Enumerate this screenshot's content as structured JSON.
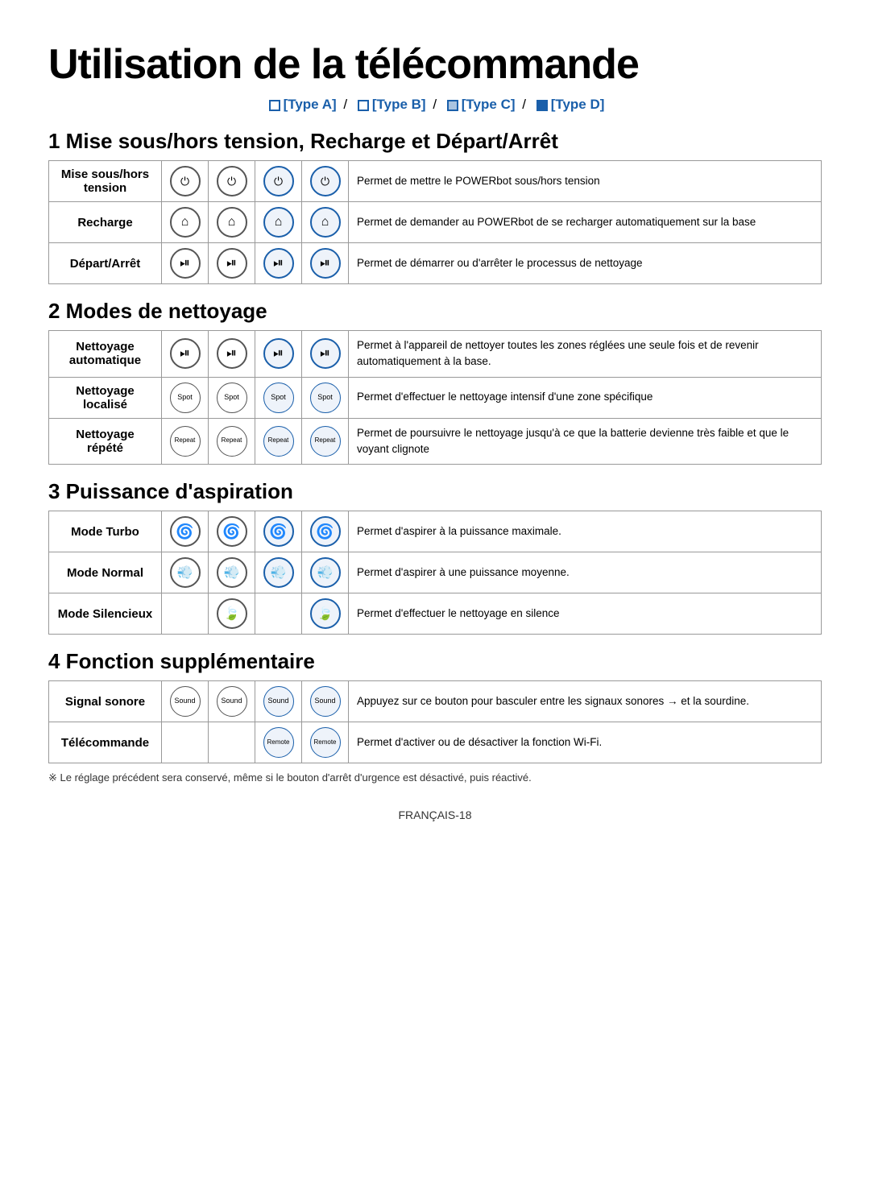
{
  "title": "Utilisation de la télécommande",
  "types": {
    "label_a": "[Type A]",
    "label_b": "[Type B]",
    "label_c": "[Type C]",
    "label_d": "[Type D]"
  },
  "section1": {
    "heading": "1 Mise sous/hors tension, Recharge et Départ/Arrêt",
    "rows": [
      {
        "label": "Mise sous/hors tension",
        "desc": "Permet de mettre le POWERbot sous/hors tension"
      },
      {
        "label": "Recharge",
        "desc": "Permet de demander au POWERbot de se recharger automatiquement sur la base"
      },
      {
        "label": "Départ/Arrêt",
        "desc": "Permet de démarrer ou d'arrêter le processus de nettoyage"
      }
    ]
  },
  "section2": {
    "heading": "2 Modes de nettoyage",
    "rows": [
      {
        "label": "Nettoyage automatique",
        "desc": "Permet à l'appareil de nettoyer toutes les zones réglées une seule fois et de revenir automatiquement à la base."
      },
      {
        "label": "Nettoyage localisé",
        "text_btn": "Spot",
        "desc": "Permet d'effectuer le nettoyage intensif d'une zone spécifique"
      },
      {
        "label": "Nettoyage répété",
        "text_btn": "Repeat",
        "desc": "Permet de poursuivre le nettoyage jusqu'à ce que la batterie devienne très faible et que le voyant clignote"
      }
    ]
  },
  "section3": {
    "heading": "3 Puissance d'aspiration",
    "rows": [
      {
        "label": "Mode Turbo",
        "desc": "Permet d'aspirer à la puissance maximale."
      },
      {
        "label": "Mode Normal",
        "desc": "Permet d'aspirer à une puissance moyenne."
      },
      {
        "label": "Mode Silencieux",
        "desc": "Permet d'effectuer le nettoyage en silence"
      }
    ]
  },
  "section4": {
    "heading": "4 Fonction supplémentaire",
    "rows": [
      {
        "label": "Signal sonore",
        "text_btn": "Sound",
        "desc": "Appuyez sur ce bouton pour basculer entre les signaux sonores → et la sourdine."
      },
      {
        "label": "Télécommande",
        "text_btn": "Remote",
        "desc": "Permet d'activer ou de désactiver la fonction Wi-Fi."
      }
    ]
  },
  "footnote": "※ Le réglage précédent sera conservé, même si le bouton d'arrêt d'urgence est désactivé, puis réactivé.",
  "page": "FRANÇAIS-18"
}
